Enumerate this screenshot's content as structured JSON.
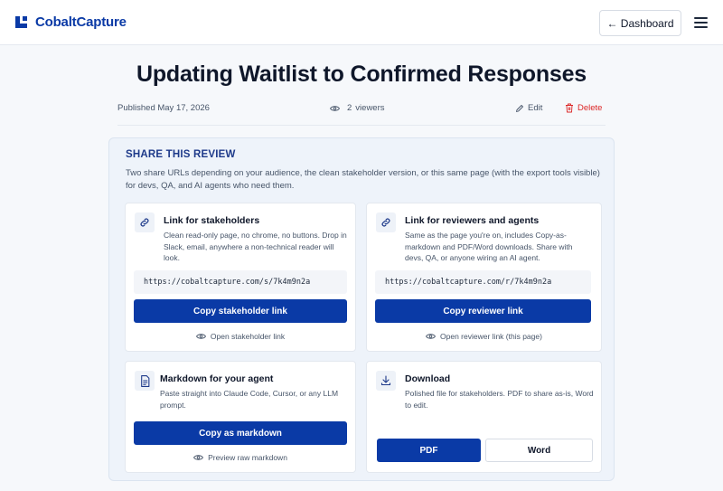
{
  "header": {
    "brand": "CobaltCapture",
    "dashboard_label": "← Dashboard"
  },
  "page": {
    "title": "Updating Waitlist to Confirmed Responses",
    "published": "Published May 17, 2026",
    "viewers_count": "2",
    "viewers_label": "viewers",
    "edit_label": "Edit",
    "delete_label": "Delete"
  },
  "share": {
    "heading": "SHARE THIS REVIEW",
    "description": "Two share URLs depending on your audience, the clean stakeholder version, or this same page (with the export tools visible) for devs, QA, and AI agents who need them.",
    "stakeholder": {
      "title": "Link for stakeholders",
      "desc": "Clean read-only page, no chrome, no buttons. Drop in Slack, email, anywhere a non-technical reader will look.",
      "url": "https://cobaltcapture.com/s/7k4m9n2a",
      "button": "Copy stakeholder link",
      "open_link": "Open stakeholder link"
    },
    "reviewer": {
      "title": "Link for reviewers and agents",
      "desc": "Same as the page you're on, includes Copy-as-markdown and PDF/Word downloads. Share with devs, QA, or anyone wiring an AI agent.",
      "url": "https://cobaltcapture.com/r/7k4m9n2a",
      "button": "Copy reviewer link",
      "open_link": "Open reviewer link (this page)"
    },
    "markdown": {
      "title": "Markdown for your agent",
      "desc": "Paste straight into Claude Code, Cursor, or any LLM prompt.",
      "button": "Copy as markdown",
      "preview_link": "Preview raw markdown"
    },
    "download": {
      "title": "Download",
      "desc": "Polished file for stakeholders. PDF to share as-is, Word to edit.",
      "pdf_label": "PDF",
      "word_label": "Word"
    }
  },
  "colors": {
    "brand": "#0a3aa6",
    "danger": "#dc2626",
    "panel_bg": "#eef3fa"
  }
}
